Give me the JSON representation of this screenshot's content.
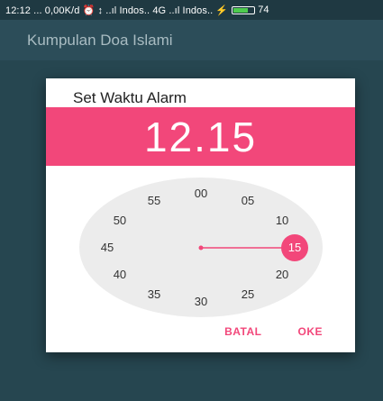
{
  "status_bar": {
    "text": "12:12 ... 0,00K/d ⏰ ↕ ..ıl Indos.. 4G ..ıl Indos.. ⚡",
    "battery": "74",
    "battery_level": 0.74,
    "battery_color": "#4ecb4e"
  },
  "app_bar": {
    "title": "Kumpulan Doa Islami"
  },
  "dialog": {
    "title": "Set Waktu Alarm",
    "time_display": "12.15",
    "accent": "#f2477a",
    "clock_labels": [
      "00",
      "05",
      "10",
      "15",
      "20",
      "25",
      "30",
      "35",
      "40",
      "45",
      "50",
      "55"
    ],
    "selected_label": "15",
    "actions": {
      "cancel": "BATAL",
      "ok": "OKE"
    }
  }
}
